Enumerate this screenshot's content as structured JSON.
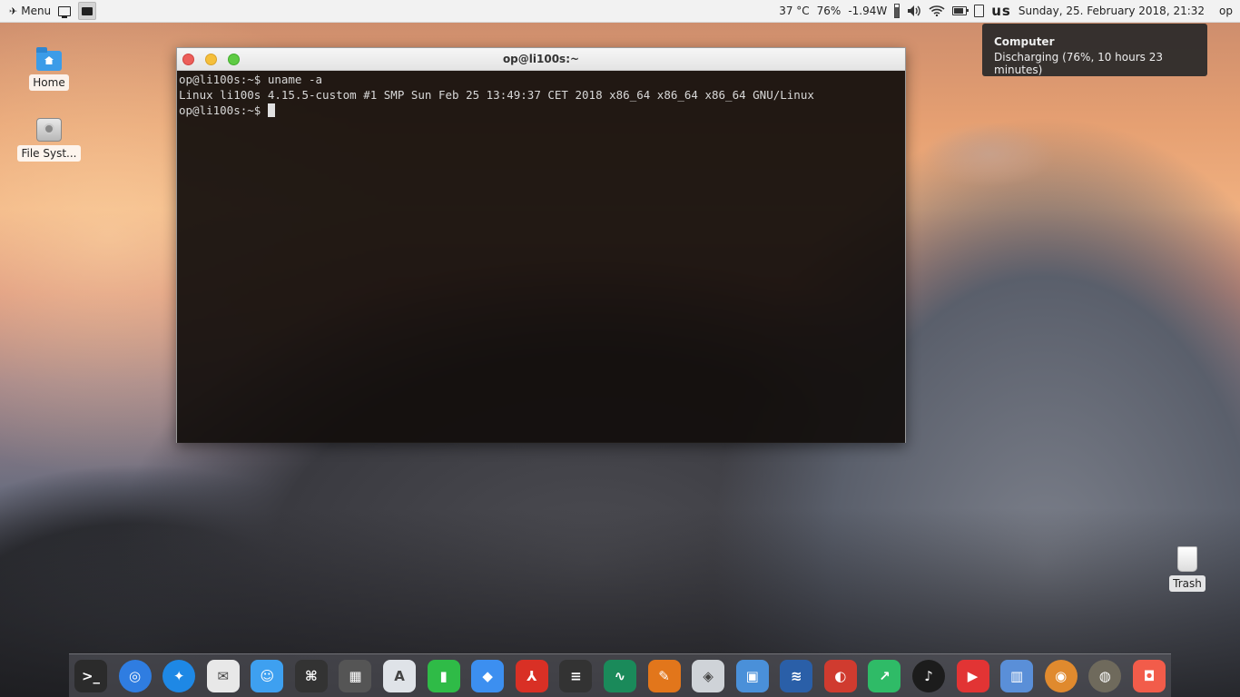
{
  "panel": {
    "menu_label": "Menu",
    "temperature": "37 °C",
    "battery_percent": "76%",
    "power_draw": "-1.94W",
    "battery_level": 0.76,
    "keyboard_layout": "us",
    "datetime": "Sunday, 25. February 2018, 21:32",
    "user": "op"
  },
  "tooltip": {
    "title": "Computer",
    "text": "Discharging (76%, 10 hours 23 minutes)"
  },
  "desktop": {
    "home_label": "Home",
    "filesystem_label": "File Syst...",
    "trash_label": "Trash"
  },
  "terminal": {
    "title": "op@li100s:~",
    "line1": "op@li100s:~$ uname -a",
    "line2": "Linux li100s 4.15.5-custom #1 SMP Sun Feb 25 13:49:37 CET 2018 x86_64 x86_64 x86_64 GNU/Linux",
    "prompt": "op@li100s:~$ "
  },
  "dock": {
    "apps": [
      {
        "name": "terminal-app-icon",
        "glyph": ">_",
        "bg": "#2b2b2b"
      },
      {
        "name": "chromium-app-icon",
        "glyph": "◎",
        "bg": "#2f7de1"
      },
      {
        "name": "safari-app-icon",
        "glyph": "✦",
        "bg": "#1e88e5"
      },
      {
        "name": "mail-app-icon",
        "glyph": "✉",
        "bg": "#e8e8e8"
      },
      {
        "name": "finder-app-icon",
        "glyph": "☺",
        "bg": "#3ea0f0"
      },
      {
        "name": "command-app-icon",
        "glyph": "⌘",
        "bg": "#333333"
      },
      {
        "name": "calculator-app-icon",
        "glyph": "▦",
        "bg": "#555555"
      },
      {
        "name": "arch-app-icon",
        "glyph": "A",
        "bg": "#dfe3e8"
      },
      {
        "name": "numbers-app-icon",
        "glyph": "▮",
        "bg": "#2fbb47"
      },
      {
        "name": "tag-app-icon",
        "glyph": "◆",
        "bg": "#3c8ff0"
      },
      {
        "name": "pdf-app-icon",
        "glyph": "⅄",
        "bg": "#d93025"
      },
      {
        "name": "document-app-icon",
        "glyph": "≡",
        "bg": "#333333"
      },
      {
        "name": "monitor-app-icon",
        "glyph": "∿",
        "bg": "#1a8a5a"
      },
      {
        "name": "gimp-app-icon",
        "glyph": "✎",
        "bg": "#e2761b"
      },
      {
        "name": "inkscape-app-icon",
        "glyph": "◈",
        "bg": "#cfd3d8"
      },
      {
        "name": "photos-app-icon",
        "glyph": "▣",
        "bg": "#4a90d9"
      },
      {
        "name": "network-app-icon",
        "glyph": "≋",
        "bg": "#2a5fa8"
      },
      {
        "name": "office-app-icon",
        "glyph": "◐",
        "bg": "#d03b2f"
      },
      {
        "name": "sheets-app-icon",
        "glyph": "↗",
        "bg": "#2fbb67"
      },
      {
        "name": "music-app-icon",
        "glyph": "♪",
        "bg": "#1c1c1c"
      },
      {
        "name": "video-app-icon",
        "glyph": "▶",
        "bg": "#e23434"
      },
      {
        "name": "audio-app-icon",
        "glyph": "▥",
        "bg": "#5a8fd8"
      },
      {
        "name": "disc-app-icon",
        "glyph": "◉",
        "bg": "#e08a2e"
      },
      {
        "name": "finder-moon-app-icon",
        "glyph": "◍",
        "bg": "#6f6a5c"
      },
      {
        "name": "screenshot-app-icon",
        "glyph": "◘",
        "bg": "#f25c4a"
      }
    ]
  }
}
